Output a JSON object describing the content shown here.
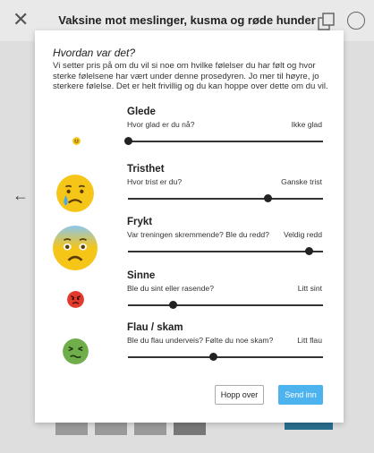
{
  "header": {
    "title": "Vaksine mot meslinger, kusma og røde hunder"
  },
  "modal": {
    "title": "Hvordan var det?",
    "description": "Vi setter pris på om du vil si noe om hvilke følelser du har følt og hvor sterke følelsene har vært under denne prosedyren. Jo mer til høyre, jo sterkere følelse. Det er helt frivillig og du kan hoppe over dette om du vil.",
    "emotions": [
      {
        "label": "Glede",
        "question": "Hvor glad er du nå?",
        "end_label": "Ikke glad",
        "level": 0.0,
        "icon": "happy-face-icon"
      },
      {
        "label": "Tristhet",
        "question": "Hvor trist er du?",
        "end_label": "Ganske trist",
        "level": 0.72,
        "icon": "crying-face-icon"
      },
      {
        "label": "Frykt",
        "question": "Var treningen skremmende? Ble du redd?",
        "end_label": "Veldig redd",
        "level": 0.93,
        "icon": "fearful-face-icon"
      },
      {
        "label": "Sinne",
        "question": "Ble du sint eller rasende?",
        "end_label": "Litt sint",
        "level": 0.23,
        "icon": "angry-face-icon"
      },
      {
        "label": "Flau / skam",
        "question": "Ble du flau underveis? Følte du noe skam?",
        "end_label": "Litt flau",
        "level": 0.44,
        "icon": "nauseated-face-icon"
      }
    ],
    "skip_label": "Hopp over",
    "send_label": "Send inn"
  },
  "colors": {
    "accent": "#4db3ee",
    "overlay": "#dedede"
  }
}
